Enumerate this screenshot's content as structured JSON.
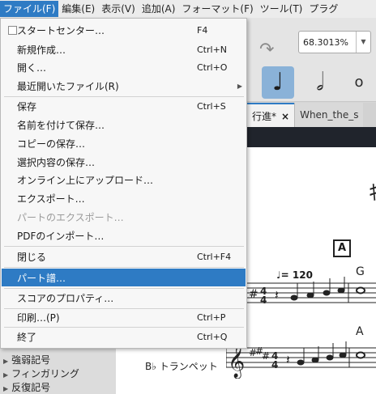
{
  "menubar": {
    "items": [
      "ファイル(F)",
      "編集(E)",
      "表示(V)",
      "追加(A)",
      "フォーマット(F)",
      "ツール(T)",
      "プラグ"
    ]
  },
  "toolbar": {
    "zoom_value": "68.3013%",
    "redo_icon": "redo-icon",
    "note_buttons": [
      "quarter-note-icon",
      "half-note-icon",
      "whole-note-icon"
    ]
  },
  "tabs": [
    {
      "label": "行進*",
      "close": "×"
    },
    {
      "label": "When_the_s"
    }
  ],
  "file_menu": {
    "items": [
      {
        "label": "スタートセンター…",
        "shortcut": "F4"
      },
      {
        "label": "新規作成…",
        "shortcut": "Ctrl+N"
      },
      {
        "label": "開く…",
        "shortcut": "Ctrl+O"
      },
      {
        "label": "最近開いたファイル(R)",
        "shortcut": ""
      },
      {
        "label": "保存",
        "shortcut": "Ctrl+S"
      },
      {
        "label": "名前を付けて保存…",
        "shortcut": ""
      },
      {
        "label": "コピーの保存…",
        "shortcut": ""
      },
      {
        "label": "選択内容の保存…",
        "shortcut": ""
      },
      {
        "label": "オンライン上にアップロード…",
        "shortcut": ""
      },
      {
        "label": "エクスポート…",
        "shortcut": ""
      },
      {
        "label": "パートのエクスポート…",
        "shortcut": ""
      },
      {
        "label": "PDFのインポート…",
        "shortcut": ""
      },
      {
        "label": "閉じる",
        "shortcut": "Ctrl+F4"
      },
      {
        "label": "パート譜…",
        "shortcut": ""
      },
      {
        "label": "スコアのプロパティ…",
        "shortcut": ""
      },
      {
        "label": "印刷…(P)",
        "shortcut": "Ctrl+P"
      },
      {
        "label": "終了",
        "shortcut": "Ctrl+Q"
      }
    ]
  },
  "palette": {
    "items": [
      "強弱記号",
      "フィンガリング",
      "反復記号"
    ]
  },
  "score": {
    "title_fragment": "ｷ",
    "rehearsal_mark": "A",
    "tempo": "♩= 120",
    "chord_1": "G",
    "chord_2": "A",
    "instrument": "B♭ トランペット"
  },
  "colors": {
    "accent": "#2e7bc4",
    "dark_bar": "#20242c",
    "menu_bg": "#f7f7f7"
  }
}
